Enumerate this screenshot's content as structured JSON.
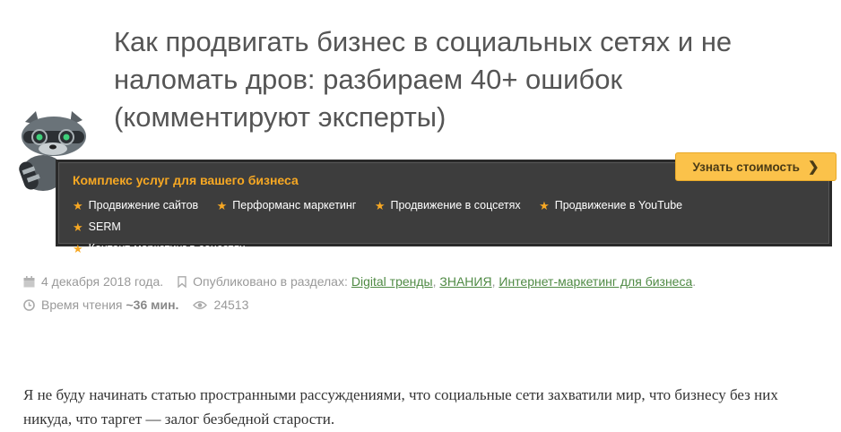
{
  "article": {
    "title": "Как продвигать бизнес в социальных сетях и не наломать дров: разбираем 40+ ошибок (комментируют эксперты)",
    "intro": "Я не буду начинать статью пространными рассуждениями, что социальные сети захватили мир, что бизнесу без них никуда, что таргет — залог безбедной старости."
  },
  "promo": {
    "title": "Комплекс услуг для вашего бизнеса",
    "services": [
      "Продвижение сайтов",
      "Перформанс маркетинг",
      "Продвижение в соцсетях",
      "Продвижение в YouTube",
      "SERM",
      "Контент-маркетинг в соцсетях"
    ],
    "cta_label": "Узнать стоимость",
    "accent": "#f7a823",
    "cta_bg": "#fbc24a",
    "bg": "#3d3d3d"
  },
  "meta": {
    "date": "4 декабря 2018 года.",
    "published_in_label": "Опубликовано в разделах:",
    "categories": [
      "Digital тренды",
      "ЗНАНИЯ",
      "Интернет-маркетинг для бизнеса"
    ],
    "reading_time_label": "Время чтения",
    "reading_time": "~36 мин.",
    "views": "24513"
  },
  "icons": {
    "calendar": "calendar-icon",
    "bookmark": "bookmark-icon",
    "clock": "clock-icon",
    "eye": "eye-icon",
    "star": "star-icon",
    "chevron": "chevron-right-icon",
    "mascot": "raccoon-mascot-icon"
  }
}
